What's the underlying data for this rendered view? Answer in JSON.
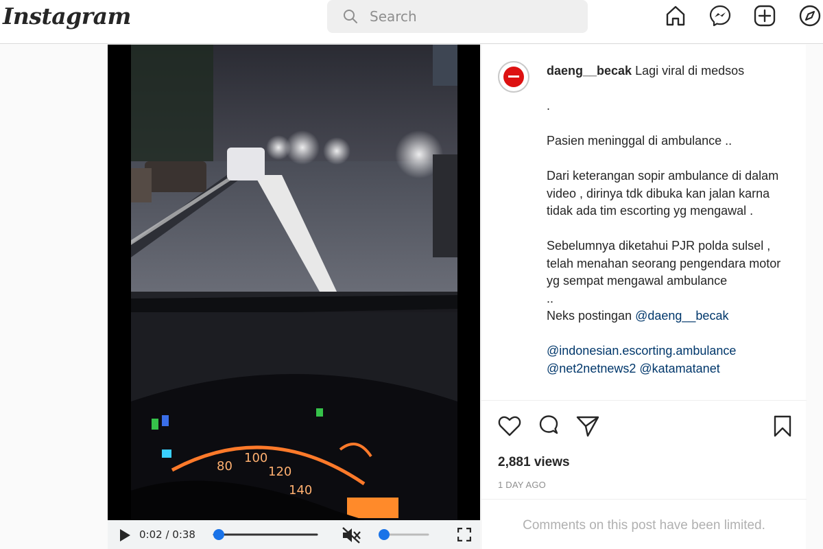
{
  "header": {
    "logo": "Instagram",
    "search_placeholder": "Search"
  },
  "nav": {
    "icons": [
      "home-icon",
      "messenger-icon",
      "new-post-icon",
      "explore-icon"
    ]
  },
  "video": {
    "time": "0:02 / 0:38",
    "progress": 0.0,
    "volume": 0.0,
    "muted": true
  },
  "post": {
    "username": "daeng__becak",
    "caption_first": "Lagi viral di medsos",
    "caption_body": ".\n\nPasien meninggal di ambulance ..\n\nDari keterangan sopir ambulance di dalam video , dirinya tdk dibuka kan jalan karna tidak ada tim escorting yg mengawal .\n\nSebelumnya diketahui PJR polda sulsel , telah menahan seorang pengendara motor yg sempat mengawal ambulance\n..\nNeks postingan ",
    "mention_1": "@daeng__becak",
    "mention_2": "@indonesian.escorting.ambulance",
    "mention_3": "@net2netnews2",
    "mention_4": "@katamatanet",
    "views": "2,881 views",
    "date": "1 DAY AGO",
    "comments_limited": "Comments on this post have been limited."
  },
  "colors": {
    "link": "#00376b",
    "muted_text": "#8e8e8e",
    "progress": "#1a73e8"
  }
}
